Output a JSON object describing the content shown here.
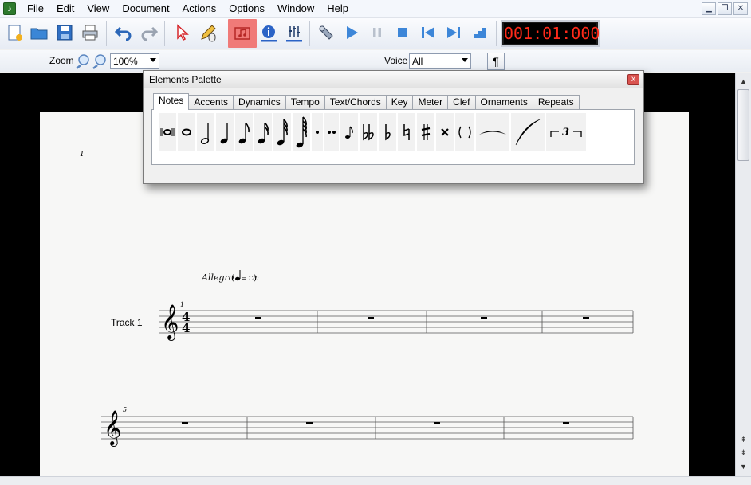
{
  "menu": {
    "items": [
      "File",
      "Edit",
      "View",
      "Document",
      "Actions",
      "Options",
      "Window",
      "Help"
    ]
  },
  "window_buttons": [
    "minimize",
    "restore",
    "close"
  ],
  "toolbar": {
    "buttons": [
      "new-document",
      "open",
      "save",
      "print",
      "undo",
      "redo",
      "select-tool",
      "edit-tool",
      "midi-input",
      "info",
      "mixer",
      "tools",
      "play",
      "pause",
      "stop",
      "rewind",
      "fast-forward",
      "record"
    ],
    "counter": "001:01:000",
    "colors": {
      "counter_text": "#ff2a1a",
      "active_button": "#f07a78"
    }
  },
  "zoombar": {
    "zoom_label": "Zoom",
    "zoom_value": "100%",
    "voice_label": "Voice",
    "voice_value": "All",
    "pilcrow": "¶"
  },
  "palette": {
    "title": "Elements Palette",
    "close": "x",
    "tabs": [
      "Notes",
      "Accents",
      "Dynamics",
      "Tempo",
      "Text/Chords",
      "Key",
      "Meter",
      "Clef",
      "Ornaments",
      "Repeats"
    ],
    "selected_tab": "Notes",
    "items": [
      "double-whole-note",
      "whole-note",
      "half-note",
      "quarter-note",
      "eighth-note",
      "sixteenth-note",
      "thirty-second-note",
      "sixty-fourth-note",
      "dot",
      "double-dot",
      "grace-note",
      "double-flat",
      "flat",
      "natural",
      "sharp",
      "double-sharp",
      "parentheses",
      "tie",
      "slur",
      "triplet"
    ],
    "triplet_label": "3"
  },
  "score": {
    "page_number": "1",
    "tempo_text": "Allegro",
    "tempo_value": "= 120",
    "track_name": "Track 1",
    "time_signature": [
      "4",
      "4"
    ],
    "system1_measure_number": "1",
    "system2_measure_number": "5"
  }
}
